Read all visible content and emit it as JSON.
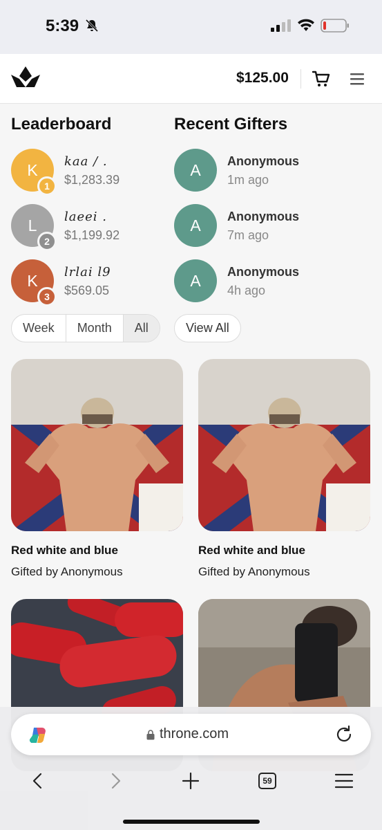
{
  "status_bar": {
    "time": "5:39"
  },
  "header": {
    "balance": "$125.00",
    "logo_icon": "crown-icon",
    "cart_icon": "cart-icon",
    "menu_icon": "hamburger-icon"
  },
  "leaderboard": {
    "title": "Leaderboard",
    "entries": [
      {
        "initial": "K",
        "rank": "1",
        "name": "kaa / .",
        "amount": "$1,283.39",
        "color": "#f2b441"
      },
      {
        "initial": "L",
        "rank": "2",
        "name": "laeei .",
        "amount": "$1,199.92",
        "color": "#a5a5a5"
      },
      {
        "initial": "K",
        "rank": "3",
        "name": "lrlai l9",
        "amount": "$569.05",
        "color": "#c6603a"
      }
    ],
    "filters": [
      "Week",
      "Month",
      "All"
    ],
    "active_filter": "All"
  },
  "recent_gifters": {
    "title": "Recent Gifters",
    "entries": [
      {
        "initial": "A",
        "name": "Anonymous",
        "time": "1m ago"
      },
      {
        "initial": "A",
        "name": "Anonymous",
        "time": "7m ago"
      },
      {
        "initial": "A",
        "name": "Anonymous",
        "time": "4h ago"
      }
    ],
    "avatar_color": "#5e9a8b",
    "view_all_label": "View All"
  },
  "gifts": [
    {
      "title": "Red white and blue",
      "gifted_by": "Gifted by Anonymous"
    },
    {
      "title": "Red white and blue",
      "gifted_by": "Gifted by Anonymous"
    },
    {
      "title": "",
      "gifted_by": ""
    },
    {
      "title": "",
      "gifted_by": ""
    }
  ],
  "browser": {
    "url": "throne.com",
    "tab_count": "59"
  }
}
